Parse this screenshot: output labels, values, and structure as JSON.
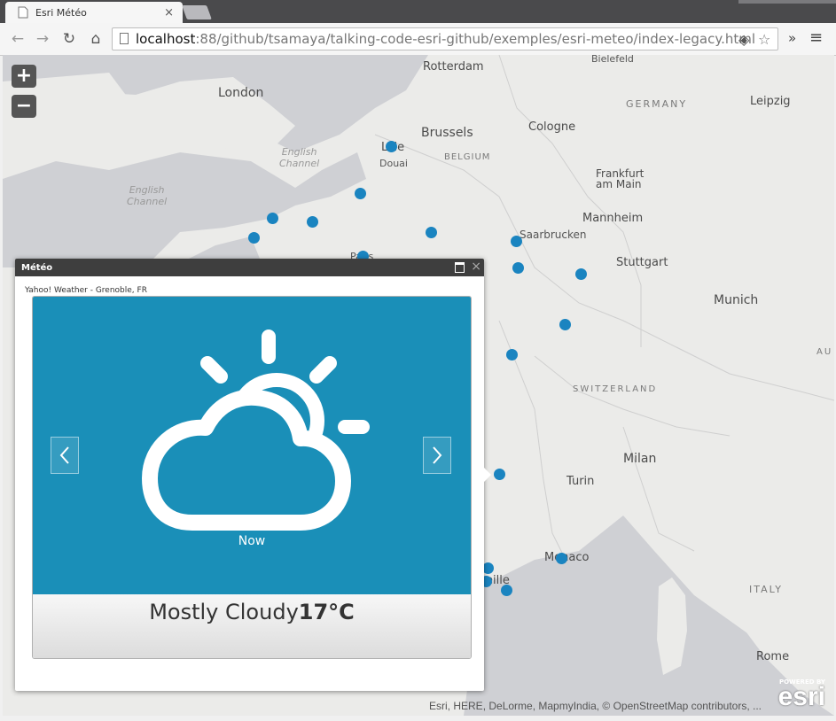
{
  "browser": {
    "tab_title": "Esri Météo",
    "tab_close": "×",
    "url_host": "localhost",
    "url_rest": ":88/github/tsamaya/talking-code-esri-github/exemples/esri-meteo/index-legacy.html",
    "overflow": "»",
    "menu": "≡"
  },
  "map": {
    "zoom_in": "+",
    "zoom_out": "−",
    "labels": {
      "rotterdam": "Rotterdam",
      "bielefeld": "Bielefeld",
      "london": "London",
      "germany": "GERMANY",
      "leipzig": "Leipzig",
      "english_channel_1": "English\nChannel",
      "english_channel_2": "English\nChannel",
      "lille": "Lille",
      "douai": "Douai",
      "brussels": "Brussels",
      "belgium": "BELGIUM",
      "cologne": "Cologne",
      "frankfurt": "Frankfurt\nam Main",
      "mannheim": "Mannheim",
      "saarbrucken": "Saarbrucken",
      "stuttgart": "Stuttgart",
      "munich": "Munich",
      "switzerland": "SWITZERLAND",
      "milan": "Milan",
      "turin": "Turin",
      "monaco": "Monaco",
      "italy": "ITALY",
      "rome": "Rome",
      "paris_partial": "Paris",
      "marseille_partial": "eille",
      "au_partial": "AU"
    },
    "attribution": "Esri, HERE, DeLorme, MapmyIndia, © OpenStreetMap contributors, ...",
    "logo_powered": "POWERED BY",
    "logo_word": "esri"
  },
  "popup": {
    "title": "Météo",
    "source": "Yahoo! Weather - Grenoble, FR",
    "now_label": "Now",
    "condition": "Mostly Cloudy",
    "temperature": "17°C",
    "close": "×"
  }
}
